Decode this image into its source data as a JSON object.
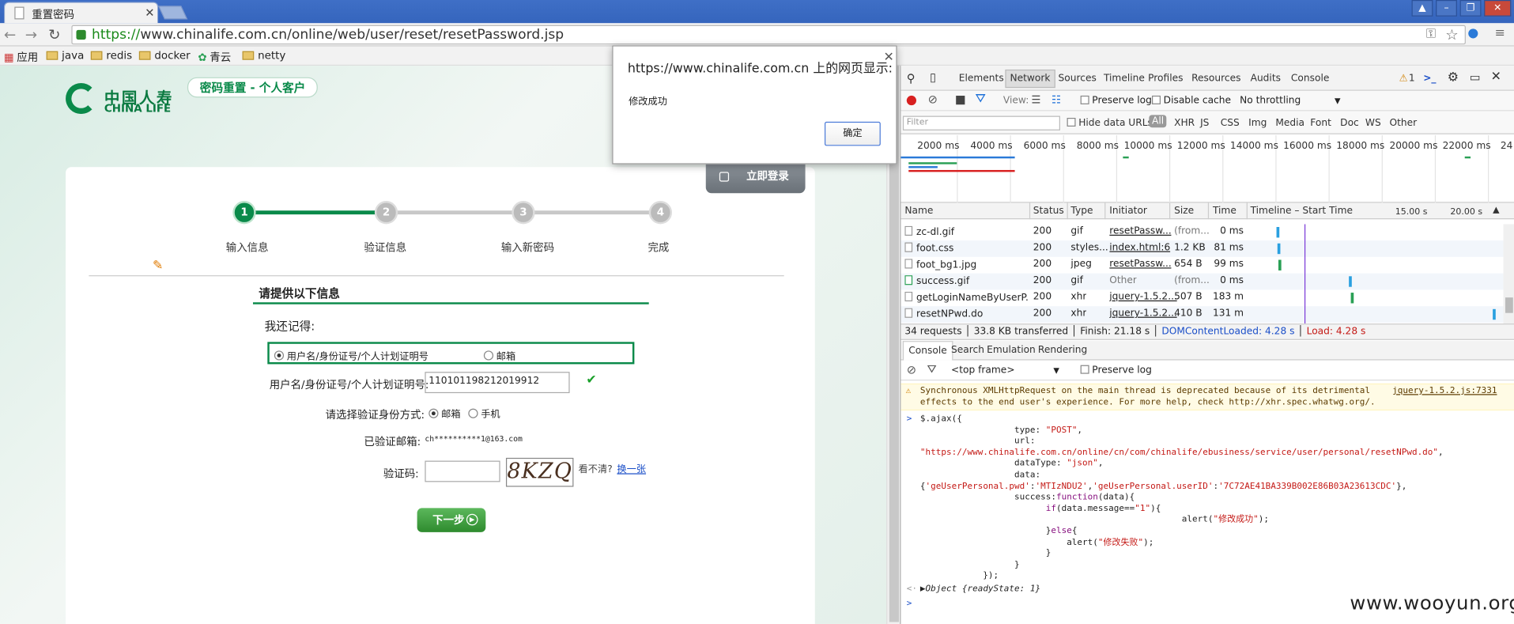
{
  "browser": {
    "tab_title": "重置密码",
    "url_proto": "https://",
    "url_rest": "www.chinalife.com.cn/online/web/user/reset/resetPassword.jsp",
    "bookmarks": [
      "应用",
      "java",
      "redis",
      "docker",
      "青云",
      "netty"
    ]
  },
  "page": {
    "logo_cn": "中国人寿",
    "logo_en": "CHINA LIFE",
    "badge": "密码重置 - 个人客户",
    "login_button": "立即登录",
    "steps": [
      {
        "num": "1",
        "label": "输入信息"
      },
      {
        "num": "2",
        "label": "验证信息"
      },
      {
        "num": "3",
        "label": "输入新密码"
      },
      {
        "num": "4",
        "label": "完成"
      }
    ],
    "section_title": "请提供以下信息",
    "remember_label": "我还记得:",
    "radio_id_label": "用户名/身份证号/个人计划证明号",
    "radio_email_label": "邮箱",
    "id_field_label": "用户名/身份证号/个人计划证明号:",
    "id_field_value": "110101198212019912",
    "verify_method_label": "请选择验证身份方式:",
    "verify_email": "邮箱",
    "verify_phone": "手机",
    "verified_email_label": "已验证邮箱:",
    "verified_email_value": "ch**********1@163.com",
    "captcha_label": "验证码:",
    "captcha_text": "8KZQ",
    "captcha_hint": "看不清?",
    "captcha_change": "换一张",
    "next_button": "下一步"
  },
  "dialog": {
    "title": "https://www.chinalife.com.cn 上的网页显示:",
    "message": "修改成功",
    "ok": "确定"
  },
  "devtools": {
    "tabs": [
      "Elements",
      "Network",
      "Sources",
      "Timeline",
      "Profiles",
      "Resources",
      "Audits",
      "Console"
    ],
    "warning_count": "1",
    "view_label": "View:",
    "preserve_log": "Preserve log",
    "disable_cache": "Disable cache",
    "throttling": "No throttling",
    "filter_placeholder": "Filter",
    "hide_data_urls": "Hide data URLs",
    "filter_types": [
      "All",
      "XHR",
      "JS",
      "CSS",
      "Img",
      "Media",
      "Font",
      "Doc",
      "WS",
      "Other"
    ],
    "timeline_labels": [
      "2000 ms",
      "4000 ms",
      "6000 ms",
      "8000 ms",
      "10000 ms",
      "12000 ms",
      "14000 ms",
      "16000 ms",
      "18000 ms",
      "20000 ms",
      "22000 ms",
      "24"
    ],
    "columns": [
      "Name",
      "Status",
      "Type",
      "Initiator",
      "Size",
      "Time",
      "Timeline – Start Time",
      "15.00 s",
      "20.00 s"
    ],
    "rows": [
      {
        "name": "zc-dl.gif",
        "status": "200",
        "type": "gif",
        "initiator": "resetPassw...",
        "size": "(from...",
        "time": "0 ms"
      },
      {
        "name": "foot.css",
        "status": "200",
        "type": "styles...",
        "initiator": "index.html:6",
        "size": "1.2 KB",
        "time": "81 ms"
      },
      {
        "name": "foot_bg1.jpg",
        "status": "200",
        "type": "jpeg",
        "initiator": "resetPassw...",
        "size": "654 B",
        "time": "99 ms"
      },
      {
        "name": "success.gif",
        "status": "200",
        "type": "gif",
        "initiator": "Other",
        "size": "(from...",
        "time": "0 ms"
      },
      {
        "name": "getLoginNameByUserP...",
        "status": "200",
        "type": "xhr",
        "initiator": "jquery-1.5.2...",
        "size": "507 B",
        "time": "183 ms"
      },
      {
        "name": "resetNPwd.do",
        "status": "200",
        "type": "xhr",
        "initiator": "jquery-1.5.2...",
        "size": "410 B",
        "time": "131 ms"
      }
    ],
    "status_requests": "34 requests",
    "status_transferred": "33.8 KB transferred",
    "status_finish": "Finish: 21.18 s",
    "status_dcl": "DOMContentLoaded: 4.28 s",
    "status_load": "Load: 4.28 s",
    "console_tabs": [
      "Console",
      "Search",
      "Emulation",
      "Rendering"
    ],
    "frame": "<top frame>",
    "console_preserve": "Preserve log",
    "warning_text_1": "Synchronous XMLHttpRequest on the main thread is deprecated because of its detrimental",
    "warning_text_2": "effects to the end user's experience. For more help, check http://xhr.spec.whatwg.org/.",
    "warning_source": "jquery-1.5.2.js:7331",
    "result": "Object {readyState: 1}"
  },
  "watermark": "www.wooyun.org"
}
